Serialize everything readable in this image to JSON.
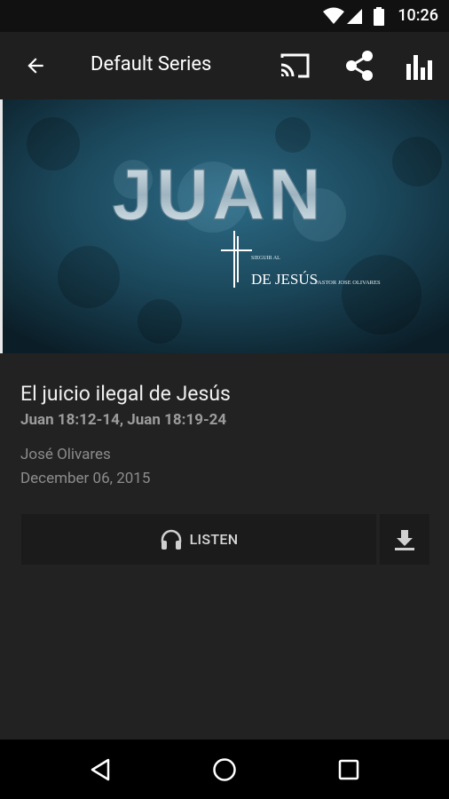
{
  "status_bar": {
    "time": "10:26"
  },
  "app_bar": {
    "title": "Default Series"
  },
  "hero": {
    "title_text": "JUAN",
    "subtitle_small": "SIEGUIR AL",
    "subtitle_main": "DE JESÚS",
    "subtitle_author": "PASTOR JOSE OLIVARES"
  },
  "sermon": {
    "title": "El juicio ilegal de Jesús",
    "scripture": "Juan 18:12-14, Juan 18:19-24",
    "speaker": "José Olivares",
    "date": "December 06, 2015"
  },
  "actions": {
    "listen_label": "LISTEN"
  },
  "colors": {
    "background": "#222222",
    "app_bar": "#1f1f1f",
    "status_bar": "#111111",
    "button": "#1b1b1b"
  }
}
